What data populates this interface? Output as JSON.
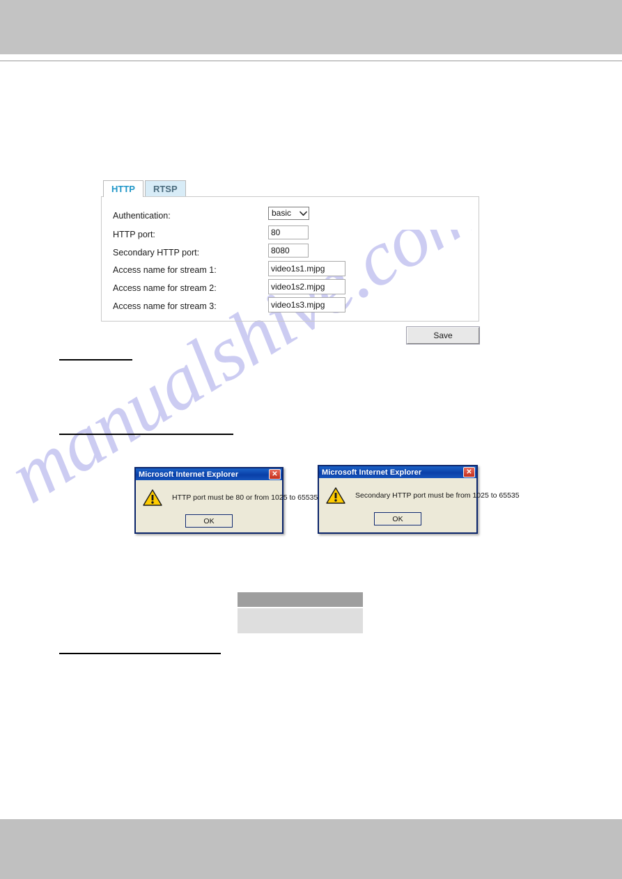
{
  "page": {
    "watermark_text": "manualshive.com"
  },
  "tabs": [
    {
      "label": "HTTP",
      "active": true
    },
    {
      "label": "RTSP",
      "active": false
    }
  ],
  "form": {
    "fields": [
      {
        "label": "Authentication:",
        "control": "select",
        "value": "basic"
      },
      {
        "label": "HTTP port:",
        "control": "input",
        "value": "80"
      },
      {
        "label": "Secondary HTTP port:",
        "control": "input",
        "value": "8080"
      },
      {
        "label": "Access name for stream 1:",
        "control": "input",
        "value": "video1s1.mjpg"
      },
      {
        "label": "Access name for stream 2:",
        "control": "input",
        "value": "video1s2.mjpg"
      },
      {
        "label": "Access name for stream 3:",
        "control": "input",
        "value": "video1s3.mjpg"
      }
    ],
    "authentication_selected": "basic",
    "http_port": "80",
    "secondary_http_port": "8080",
    "stream1": "video1s1.mjpg",
    "stream2": "video1s2.mjpg",
    "stream3": "video1s3.mjpg",
    "save_label": "Save"
  },
  "dialogs": [
    {
      "title": "Microsoft Internet Explorer",
      "message": "HTTP port must be 80 or from 1025 to 65535",
      "ok_label": "OK",
      "close_glyph": "✕"
    },
    {
      "title": "Microsoft Internet Explorer",
      "message": "Secondary HTTP port must be from 1025 to 65535",
      "ok_label": "OK",
      "close_glyph": "✕"
    }
  ],
  "colors": {
    "tab_active_text": "#2197c8",
    "tab_inactive_bg": "#d8ecf7",
    "dialog_titlebar": "#0a3fa8",
    "dialog_close": "#c42f1c",
    "warning_yellow": "#ffcc00",
    "table_header_gray": "#9e9e9e",
    "table_body_gray": "#dedede",
    "band_gray": "#c3c3c3",
    "watermark": "#ccccf2"
  }
}
